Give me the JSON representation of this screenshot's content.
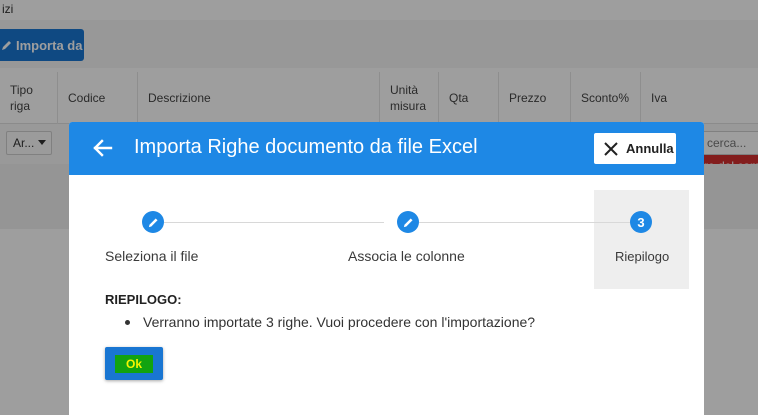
{
  "background": {
    "topbar_text": "izi",
    "import_button": "Importa da",
    "columns": [
      {
        "label": "Tipo\nriga"
      },
      {
        "label": "Codice"
      },
      {
        "label": "Descrizione"
      },
      {
        "label": "Unità\nmisura"
      },
      {
        "label": "Qta"
      },
      {
        "label": "Prezzo"
      },
      {
        "label": "Sconto%"
      },
      {
        "label": "Iva"
      }
    ],
    "row_type_value": "Ar...",
    "search_placeholder": "cerca...",
    "error_text": "re del cam"
  },
  "dialog": {
    "title": "Importa Righe documento da file Excel",
    "cancel_label": "Annulla",
    "steps": [
      {
        "label": "Seleziona il file",
        "marker": "edit-icon"
      },
      {
        "label": "Associa le colonne",
        "marker": "edit-icon"
      },
      {
        "label": "Riepilogo",
        "marker": "3"
      }
    ],
    "summary_title": "RIEPILOGO:",
    "summary_items": [
      "Verranno importate 3 righe. Vuoi procedere con l'importazione?"
    ],
    "ok_label": "Ok"
  },
  "colors": {
    "header_blue": "#1e88e5",
    "button_blue": "#1976d2",
    "ok_highlight": "#12a310",
    "ok_text": "#f5f500",
    "error_red": "#d32f2f"
  }
}
